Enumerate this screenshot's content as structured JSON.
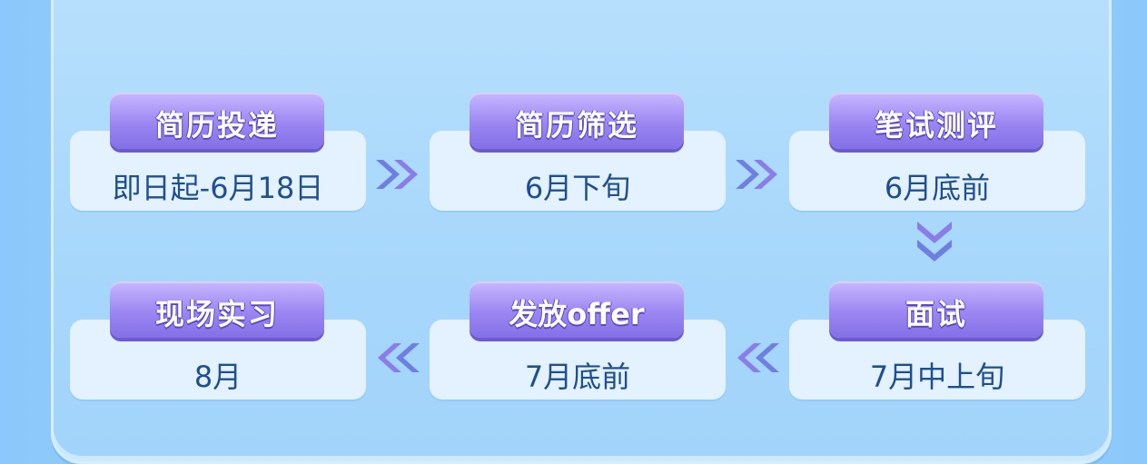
{
  "steps": [
    {
      "label": "简历投递",
      "value": "即日起-6月18日"
    },
    {
      "label": "简历筛选",
      "value": "6月下旬"
    },
    {
      "label": "笔试测评",
      "value": "6月底前"
    },
    {
      "label": "面试",
      "value": "7月中上旬"
    },
    {
      "label": "发放offer",
      "value": "7月底前"
    },
    {
      "label": "现场实习",
      "value": "8月"
    }
  ],
  "colors": {
    "background": "#a6d6fc",
    "card": "#e3f2fe",
    "tag": "#9b86f2",
    "value_text": "#1f4f8e",
    "arrow": "#6f7fe0"
  },
  "icons": {
    "arrow_right": "double-chevron-right-icon",
    "arrow_left": "double-chevron-left-icon",
    "arrow_down": "double-chevron-down-icon"
  }
}
